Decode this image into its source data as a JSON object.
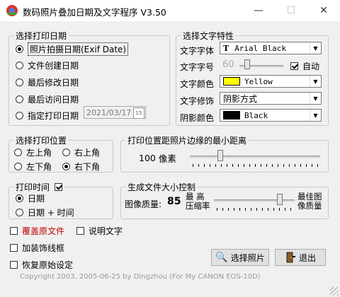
{
  "title": "数码照片叠加日期及文字程序 V3.50",
  "colors": {
    "accent_red": "#c00000",
    "text_yellow_swatch": "#ffff00",
    "shadow_black": "#000000"
  },
  "print_date": {
    "legend": "选择打印日期",
    "options": [
      "照片拍摄日期(Exif Date)",
      "文件创建日期",
      "最后修改日期",
      "最后访问日期",
      "指定打印日期"
    ],
    "selected_index": 0,
    "date_value": "2021/03/17"
  },
  "text_props": {
    "legend": "选择文字特性",
    "font_label": "文字字体",
    "font_value": "Arial Black",
    "size_label": "文字字号",
    "size_value": "60",
    "auto_label": "自动",
    "auto_checked": true,
    "color_label": "文字颜色",
    "color_value": "Yellow",
    "decor_label": "文字修饰",
    "decor_value": "阴影方式",
    "shadow_label": "阴影颜色",
    "shadow_value": "Black"
  },
  "position": {
    "legend": "选择打印位置",
    "options": [
      "左上角",
      "右上角",
      "左下角",
      "右下角"
    ],
    "selected_index": 3
  },
  "margin": {
    "legend": "打印位置距照片边缘的最小距离",
    "value": "100",
    "unit": "像素"
  },
  "print_time": {
    "legend": "打印时间",
    "enabled": true,
    "options": [
      "日期",
      "日期 + 时间"
    ],
    "selected_index": 0
  },
  "file_size": {
    "legend": "生成文件大小控制",
    "quality_label": "图像质量:",
    "quality_value": "85",
    "left_top": "最 高",
    "left_bottom": "压缩率",
    "right_top": "最佳图",
    "right_bottom": "像质量"
  },
  "checkboxes": {
    "overwrite": "覆盖原文件",
    "caption": "说明文字",
    "border": "加装饰线框",
    "restore": "恢复原始设定"
  },
  "buttons": {
    "select_photo": "选择照片",
    "exit": "退出"
  },
  "footer": "Copyright 2003, 2005-06-25 by Dingzhou      (For My CANON EOS-10D)"
}
